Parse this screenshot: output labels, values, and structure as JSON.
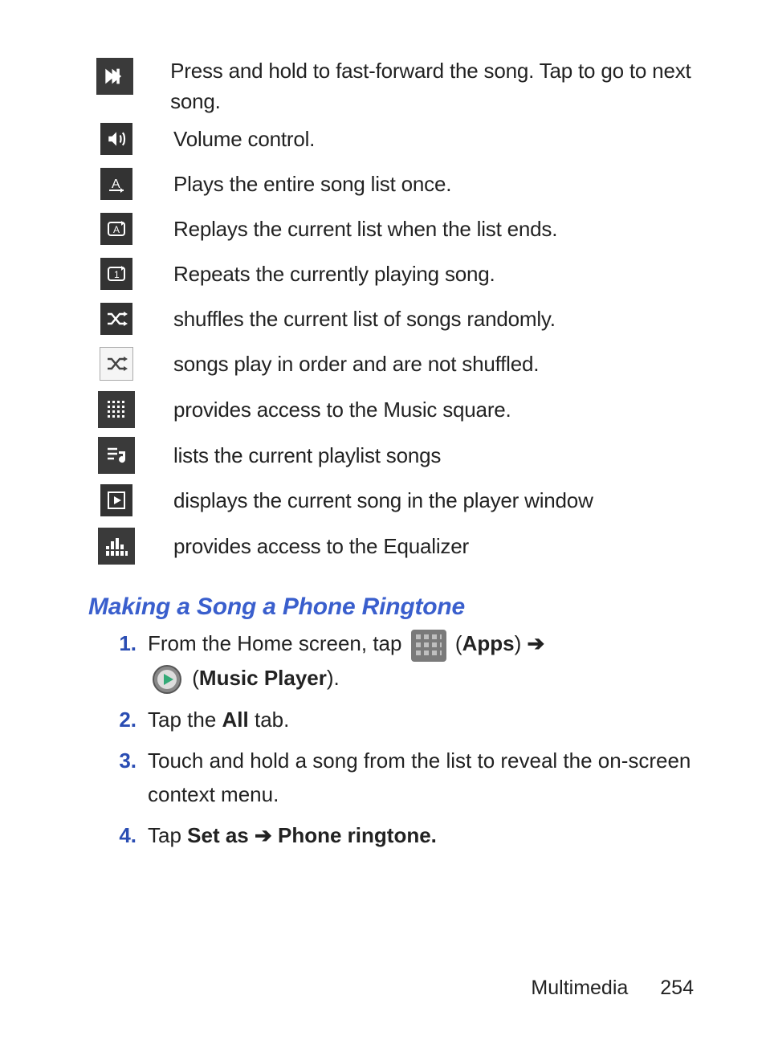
{
  "icon_list": [
    {
      "name": "fast-forward-icon",
      "desc": "Press and hold to fast-forward  the song. Tap to go to next song."
    },
    {
      "name": "volume-icon",
      "desc": "Volume control."
    },
    {
      "name": "play-all-once-icon",
      "desc": "Plays the entire song list once."
    },
    {
      "name": "repeat-list-icon",
      "desc": "Replays the current list when the list ends."
    },
    {
      "name": "repeat-one-icon",
      "desc": "Repeats the currently playing song."
    },
    {
      "name": "shuffle-on-icon",
      "desc": "shuffles the current list of songs randomly."
    },
    {
      "name": "shuffle-off-icon",
      "desc": "songs play in order and are not shuffled."
    },
    {
      "name": "music-square-icon",
      "desc": "provides access to the Music square."
    },
    {
      "name": "playlist-icon",
      "desc": "lists the current playlist songs"
    },
    {
      "name": "now-playing-icon",
      "desc": "displays the current song in the player window"
    },
    {
      "name": "equalizer-icon",
      "desc": "provides access to the Equalizer"
    }
  ],
  "section_heading": "Making a Song a Phone Ringtone",
  "steps": {
    "s1_pre": "From the Home screen, tap ",
    "s1_apps_open": " (",
    "s1_apps": "Apps",
    "s1_apps_close": ") ",
    "s1_arrow": "➔",
    "s1_mp_open": " (",
    "s1_mp": "Music Player",
    "s1_mp_close": ").",
    "s2_pre": "Tap the ",
    "s2_all": "All",
    "s2_post": " tab.",
    "s3": "Touch and hold a song from the list to reveal the on-screen context menu.",
    "s4_pre": "Tap ",
    "s4_setas": "Set as ",
    "s4_arrow": "➔",
    "s4_ring": " Phone ringtone."
  },
  "footer": {
    "section": "Multimedia",
    "page": "254"
  }
}
